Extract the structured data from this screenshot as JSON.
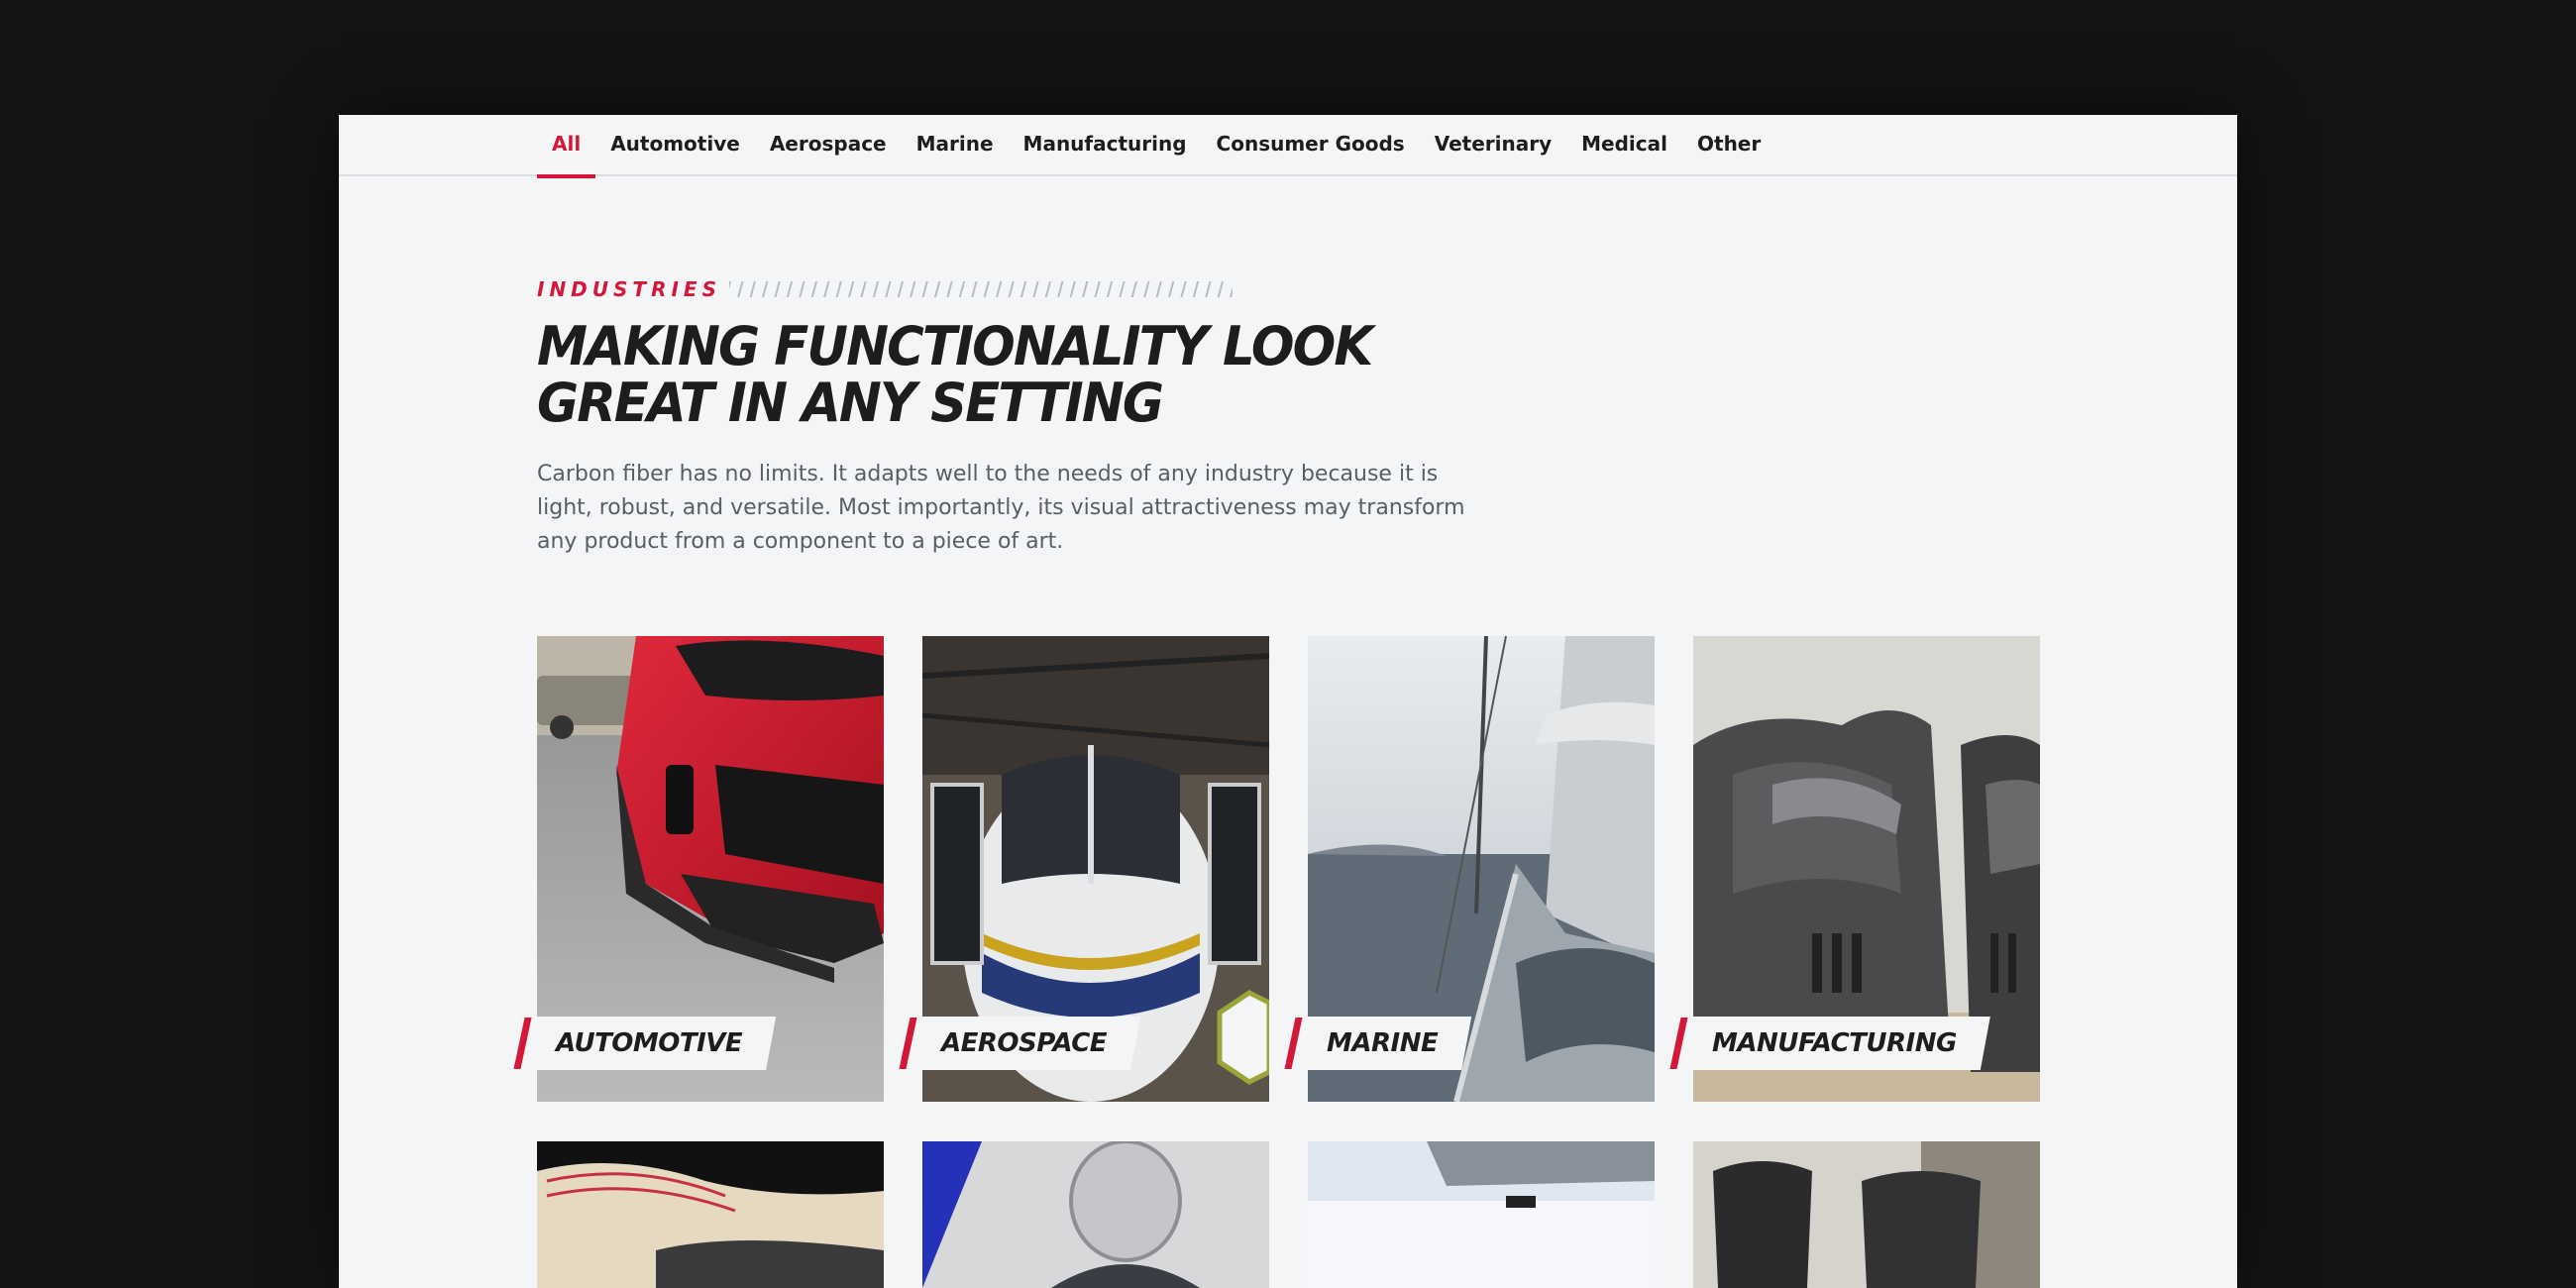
{
  "tabs": [
    {
      "label": "All",
      "active": true
    },
    {
      "label": "Automotive"
    },
    {
      "label": "Aerospace"
    },
    {
      "label": "Marine"
    },
    {
      "label": "Manufacturing"
    },
    {
      "label": "Consumer Goods"
    },
    {
      "label": "Veterinary"
    },
    {
      "label": "Medical"
    },
    {
      "label": "Other"
    }
  ],
  "intro": {
    "eyebrow": "INDUSTRIES",
    "headline_line1": "MAKING FUNCTIONALITY LOOK",
    "headline_line2": "GREAT IN ANY SETTING",
    "body": "Carbon fiber has no limits. It adapts well to the needs of any industry because it is light, robust, and versatile. Most importantly, its visual attractiveness may transform any product from a component to a piece of art."
  },
  "cards": [
    {
      "label": "AUTOMOTIVE"
    },
    {
      "label": "AEROSPACE"
    },
    {
      "label": "MARINE"
    },
    {
      "label": "MANUFACTURING"
    }
  ],
  "colors": {
    "accent": "#d3183a",
    "page_bg": "#f4f5f7",
    "frame_bg": "#141414",
    "text_dark": "#1d1d1f",
    "text_muted": "#5a5d66"
  }
}
